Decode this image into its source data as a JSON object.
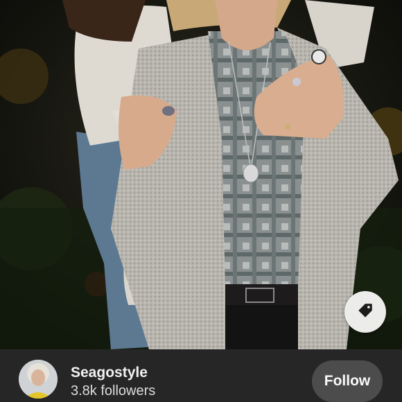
{
  "profile": {
    "username": "Seagostyle",
    "followers": "3.8k followers"
  },
  "actions": {
    "follow_label": "Follow"
  },
  "icons": {
    "tag": "price-tag-icon",
    "avatar": "profile-photo"
  },
  "colors": {
    "footer_background": "#262626",
    "follow_button": "#4c4c4c",
    "tag_button": "#ecedeb"
  }
}
